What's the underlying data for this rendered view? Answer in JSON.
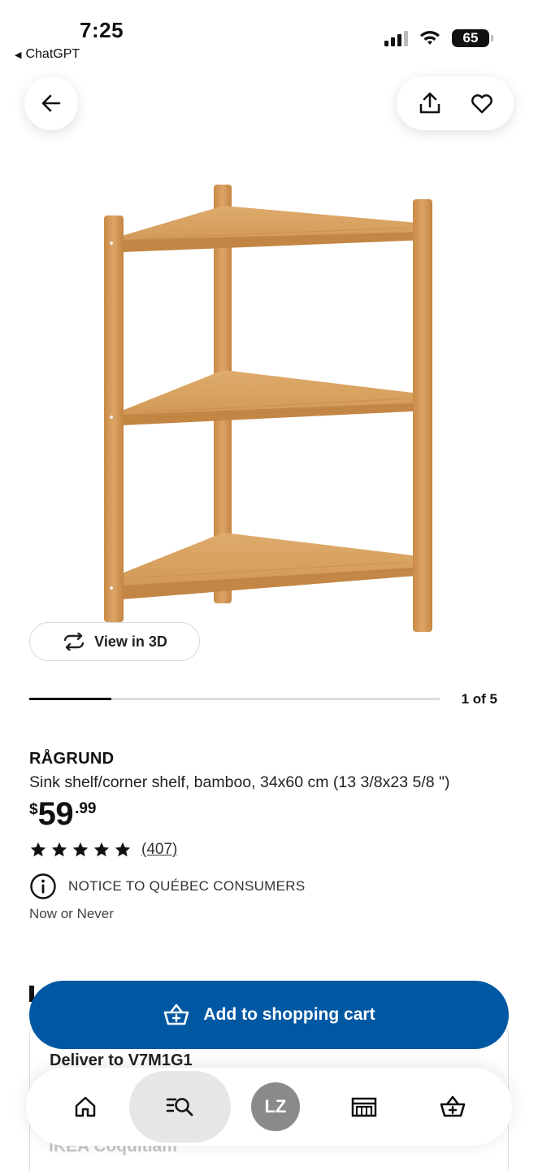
{
  "status_bar": {
    "time": "7:25",
    "back_app": "ChatGPT",
    "battery": "65"
  },
  "carousel": {
    "view3d_label": "View in 3D",
    "page_indicator": "1 of 5",
    "progress": 0.2
  },
  "product": {
    "name": "RÅGRUND",
    "description": "Sink shelf/corner shelf, bamboo, 34x60 cm (13 3/8x23 5/8 \")",
    "price": {
      "currency": "$",
      "integer": "59",
      "decimal": ".99"
    },
    "rating": {
      "stars": 5,
      "count": "(407)"
    },
    "notice": "NOTICE TO QUÉBEC CONSUMERS",
    "tag_line": "Now or Never"
  },
  "delivery": {
    "title": "Deliver to V7M1G1",
    "store": "IKEA Coquitlam"
  },
  "cart_button": {
    "label": "Add to shopping cart"
  },
  "bottom_nav": {
    "items": [
      {
        "name": "home",
        "icon": "home-icon"
      },
      {
        "name": "search",
        "icon": "search-list-icon",
        "active": true
      },
      {
        "name": "profile",
        "initials": "LZ"
      },
      {
        "name": "store",
        "icon": "store-icon"
      },
      {
        "name": "cart",
        "icon": "basket-icon"
      }
    ]
  },
  "colors": {
    "primary": "#0058a3",
    "avatar": "#8a8a8a"
  }
}
